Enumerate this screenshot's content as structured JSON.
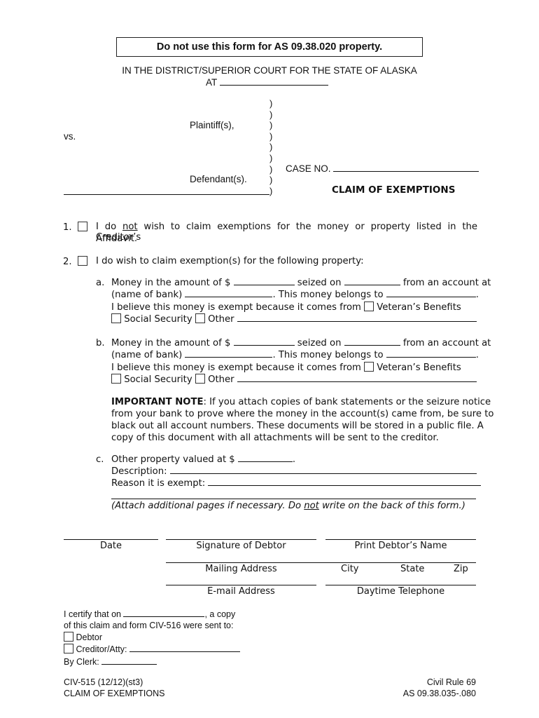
{
  "banner": "Do not use this form for AS 09.38.020 property.",
  "court": {
    "line1": "IN THE DISTRICT/SUPERIOR COURT FOR THE STATE OF ALASKA",
    "at_label": "AT",
    "at_value": ""
  },
  "caption": {
    "plaintiff_label": "Plaintiff(s),",
    "vs_label": "vs.",
    "defendant_label": "Defendant(s).",
    "case_no_label": "CASE NO.",
    "case_no_value": "",
    "paren": ")",
    "form_title": "CLAIM OF EXEMPTIONS"
  },
  "items": {
    "item1": {
      "number": "1.",
      "checked": false,
      "text_pre": "I do",
      "text_emph": "not",
      "text_post": "wish to claim exemptions for the money or property listed in the Creditor’s",
      "text_line2": "Affidavit."
    },
    "item2": {
      "number": "2.",
      "checked": false,
      "text": "I do wish to claim exemption(s) for the following property:"
    }
  },
  "money_a": {
    "letter": "a.",
    "amount_label": "Money in the amount of $",
    "seized_label": "seized on",
    "from_label": "from an account at",
    "bank_label": "(name of bank)",
    "belongs_label": ". This money belongs to",
    "exempt_label": "I believe this money is exempt because it comes from",
    "veterans_label": "Veteran’s Benefits",
    "social_label": "Social Security",
    "other_label": "Other"
  },
  "money_b": {
    "letter": "b.",
    "amount_label": "Money in the amount of $",
    "seized_label": "seized on",
    "from_label": "from an account at",
    "bank_label": "(name of bank)",
    "belongs_label": ". This money belongs to",
    "exempt_label": "I believe this money is exempt because it comes from",
    "veterans_label": "Veteran’s Benefits",
    "social_label": "Social Security",
    "other_label": "Other"
  },
  "important_note": {
    "label": "IMPORTANT NOTE",
    "line1": ":  If you attach copies of bank statements or the seizure notice",
    "line2": "from your bank to prove where the money in the account(s) came from, be sure to",
    "line3": "black out all account numbers.  These documents will be stored in a public file.  A",
    "line4": "copy of this document with all attachments will be sent to the creditor."
  },
  "other_property": {
    "letter": "c.",
    "valued_label": "Other property valued at $",
    "description_label": "Description:",
    "reason_label": "Reason it is exempt:",
    "attach_pre": "(Attach additional pages if necessary. Do",
    "attach_emph": "not",
    "attach_post": "write on the back of this form.)"
  },
  "signature": {
    "date": "Date",
    "signature_of_debtor": "Signature of Debtor",
    "print_name": "Print Debtor’s Name",
    "mailing_address": "Mailing Address",
    "city": "City",
    "state": "State",
    "zip": "Zip",
    "email": "E-mail Address",
    "phone": "Daytime Telephone"
  },
  "certify": {
    "line1_pre": "I certify that on",
    "line1_post": ", a copy",
    "line2": "of this claim and form CIV-516 were sent to:",
    "debtor_label": "Debtor",
    "creditor_label": "Creditor/Atty:",
    "clerk_label": "By Clerk:"
  },
  "footer": {
    "form_id": "CIV-515 (12/12)(st3)",
    "form_name": "CLAIM OF EXEMPTIONS",
    "rule": "Civil Rule 69",
    "statute": "AS 09.38.035-.080"
  }
}
